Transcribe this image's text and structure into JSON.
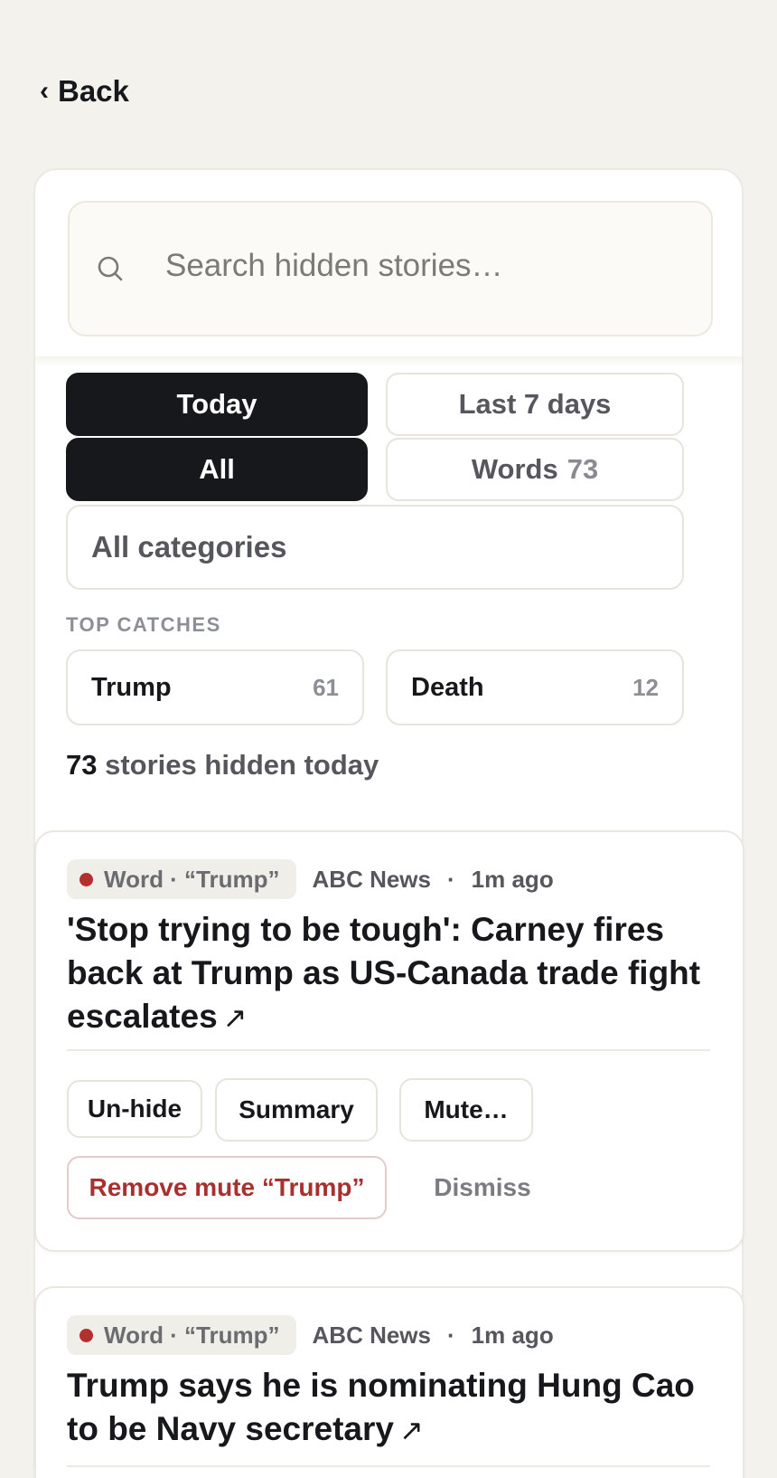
{
  "nav": {
    "back_label": "Back",
    "back_chevron": "‹"
  },
  "search": {
    "placeholder": "Search hidden stories…",
    "value": "",
    "icon": "search-icon"
  },
  "filters": {
    "range": [
      {
        "label": "Today",
        "active": true
      },
      {
        "label": "Last 7 days",
        "active": false
      }
    ],
    "type": [
      {
        "label": "All",
        "active": true
      },
      {
        "label": "Words",
        "count": "73",
        "active": false
      }
    ],
    "category": "All categories"
  },
  "top_catches": {
    "label": "TOP CATCHES",
    "items": [
      {
        "term": "Trump",
        "count": "61"
      },
      {
        "term": "Death",
        "count": "12"
      }
    ]
  },
  "summary": {
    "count": "73",
    "text": "stories hidden today"
  },
  "stories": [
    {
      "tag": "Word · “Trump”",
      "source": "ABC News",
      "separator": "·",
      "time": "1m ago",
      "headline": "'Stop trying to be tough': Carney fires back at Trump as US-Canada trade fight escalates",
      "external_icon": "↗",
      "actions": {
        "unhide": "Un-hide",
        "summary": "Summary",
        "mute": "Mute…",
        "remove_mute": "Remove mute “Trump”",
        "dismiss": "Dismiss"
      }
    },
    {
      "tag": "Word · “Trump”",
      "source": "ABC News",
      "separator": "·",
      "time": "1m ago",
      "headline": "Trump says he is nominating Hung Cao to be Navy secretary",
      "external_icon": "↗"
    }
  ],
  "colors": {
    "background": "#f3f2ed",
    "dark": "#17181b",
    "accent_red": "#b3302f",
    "muted": "#55575d"
  }
}
